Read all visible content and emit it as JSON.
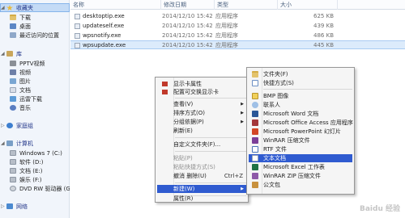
{
  "sidebar": {
    "items": [
      {
        "label": "收藏夹",
        "icon": "star-icon"
      },
      {
        "label": "下载",
        "icon": "download-folder-icon"
      },
      {
        "label": "桌面",
        "icon": "desktop-icon"
      },
      {
        "label": "最近访问的位置",
        "icon": "recent-places-icon"
      },
      {
        "label": "库",
        "icon": "library-icon"
      },
      {
        "label": "PPTV视频",
        "icon": "pptv-icon"
      },
      {
        "label": "视频",
        "icon": "video-icon"
      },
      {
        "label": "图片",
        "icon": "picture-icon"
      },
      {
        "label": "文档",
        "icon": "document-icon"
      },
      {
        "label": "迅雷下载",
        "icon": "xunlei-download-icon"
      },
      {
        "label": "音乐",
        "icon": "music-icon"
      },
      {
        "label": "家庭组",
        "icon": "homegroup-icon"
      },
      {
        "label": "计算机",
        "icon": "computer-icon"
      },
      {
        "label": "Windows 7 (C:)",
        "icon": "drive-icon"
      },
      {
        "label": "软件 (D:)",
        "icon": "drive-icon"
      },
      {
        "label": "文档 (E:)",
        "icon": "drive-icon"
      },
      {
        "label": "娱乐 (F:)",
        "icon": "drive-icon"
      },
      {
        "label": "DVD RW 驱动器 (G:)",
        "icon": "dvd-drive-icon"
      },
      {
        "label": "网络",
        "icon": "network-icon"
      }
    ]
  },
  "columns": {
    "name": "名称",
    "date": "修改日期",
    "type": "类型",
    "size": "大小"
  },
  "files": [
    {
      "name": "desktoptip.exe",
      "date": "2014/12/10 15:42",
      "type": "应用程序",
      "size": "625 KB"
    },
    {
      "name": "updateself.exe",
      "date": "2014/12/10 15:42",
      "type": "应用程序",
      "size": "439 KB"
    },
    {
      "name": "wpsnotify.exe",
      "date": "2014/12/10 15:42",
      "type": "应用程序",
      "size": "486 KB"
    },
    {
      "name": "wpsupdate.exe",
      "date": "2014/12/10 15:42",
      "type": "应用程序",
      "size": "445 KB"
    }
  ],
  "context_menu": {
    "items": [
      {
        "label": "显示卡属性"
      },
      {
        "label": "配置可交换显示卡"
      },
      {
        "label": "查看(V)"
      },
      {
        "label": "排序方式(O)"
      },
      {
        "label": "分组依据(P)"
      },
      {
        "label": "刷新(E)"
      },
      {
        "label": "自定义文件夹(F)..."
      },
      {
        "label": "粘贴(P)"
      },
      {
        "label": "粘贴快捷方式(S)"
      },
      {
        "label": "撤消 删除(U)",
        "shortcut": "Ctrl+Z"
      },
      {
        "label": "新建(W)"
      },
      {
        "label": "属性(R)"
      }
    ]
  },
  "new_submenu": {
    "items": [
      {
        "label": "文件夹(F)",
        "icon": "folder-icon"
      },
      {
        "label": "快捷方式(S)",
        "icon": "shortcut-icon"
      },
      {
        "label": "BMP 图像",
        "icon": "bmp-icon"
      },
      {
        "label": "联系人",
        "icon": "contact-icon"
      },
      {
        "label": "Microsoft Word 文档",
        "icon": "word-icon"
      },
      {
        "label": "Microsoft Office Access 应用程序",
        "icon": "access-icon"
      },
      {
        "label": "Microsoft PowerPoint 幻灯片",
        "icon": "powerpoint-icon"
      },
      {
        "label": "WinRAR 压缩文件",
        "icon": "winrar-icon"
      },
      {
        "label": "RTF 文件",
        "icon": "rtf-icon"
      },
      {
        "label": "文本文档",
        "icon": "text-document-icon"
      },
      {
        "label": "Microsoft Excel 工作表",
        "icon": "excel-icon"
      },
      {
        "label": "WinRAR ZIP 压缩文件",
        "icon": "winrar-zip-icon"
      },
      {
        "label": "公文包",
        "icon": "briefcase-icon"
      }
    ]
  },
  "watermark": "Baidu 经验"
}
